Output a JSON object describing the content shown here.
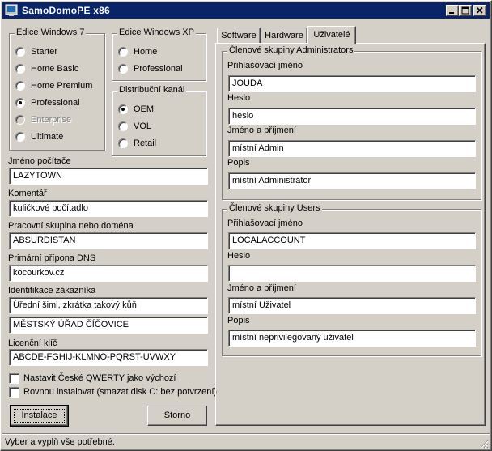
{
  "window": {
    "title": "SamoDomoPE x86",
    "minimize_glyph": "_",
    "maximize_glyph": "□",
    "close_glyph": "×"
  },
  "windows7": {
    "legend": "Edice Windows 7",
    "options": [
      "Starter",
      "Home Basic",
      "Home Premium",
      "Professional",
      "Enterprise",
      "Ultimate"
    ],
    "selected": "Professional",
    "disabled": [
      "Enterprise"
    ]
  },
  "windowsxp": {
    "legend": "Edice Windows XP",
    "options": [
      "Home",
      "Professional"
    ],
    "selected": ""
  },
  "channel": {
    "legend": "Distribuční kanál",
    "options": [
      "OEM",
      "VOL",
      "Retail"
    ],
    "selected": "OEM"
  },
  "form": {
    "computer_name_label": "Jméno počítače",
    "computer_name": "LAZYTOWN",
    "comment_label": "Komentář",
    "comment": "kuličkové počítadlo",
    "workgroup_label": "Pracovní skupina nebo doména",
    "workgroup": "ABSURDISTAN",
    "dns_label": "Primární přípona DNS",
    "dns": "kocourkov.cz",
    "customer_label": "Identifikace zákazníka",
    "customer_name": "Úřední šiml, zkrátka takový kůň",
    "customer_org": "MĚSTSKÝ ÚŘAD ČÍČOVICE",
    "license_label": "Licenční klíč",
    "license_key": "ABCDE-FGHIJ-KLMNO-PQRST-UVWXY"
  },
  "checks": {
    "qwerty": "Nastavit České QWERTY jako výchozí",
    "format": "Rovnou instalovat (smazat disk C: bez potvrzení)"
  },
  "buttons": {
    "install": "Instalace",
    "cancel": "Storno"
  },
  "tabs": [
    "Software",
    "Hardware",
    "Uživatelé"
  ],
  "active_tab": "Uživatelé",
  "admins": {
    "legend": "Členové skupiny Administrators",
    "login_label": "Přihlašovací jméno",
    "login": "JOUDA",
    "password_label": "Heslo",
    "password": "heslo",
    "fullname_label": "Jméno a příjmení",
    "fullname": "místní Admin",
    "description_label": "Popis",
    "description": "místní Administrátor"
  },
  "users": {
    "legend": "Členové skupiny Users",
    "login_label": "Přihlašovací jméno",
    "login": "LOCALACCOUNT",
    "password_label": "Heslo",
    "password": "",
    "fullname_label": "Jméno a příjmení",
    "fullname": "místní Uživatel",
    "description_label": "Popis",
    "description": "místní neprivilegovaný uživatel"
  },
  "status": "Vyber a vyplň vše potřebné."
}
